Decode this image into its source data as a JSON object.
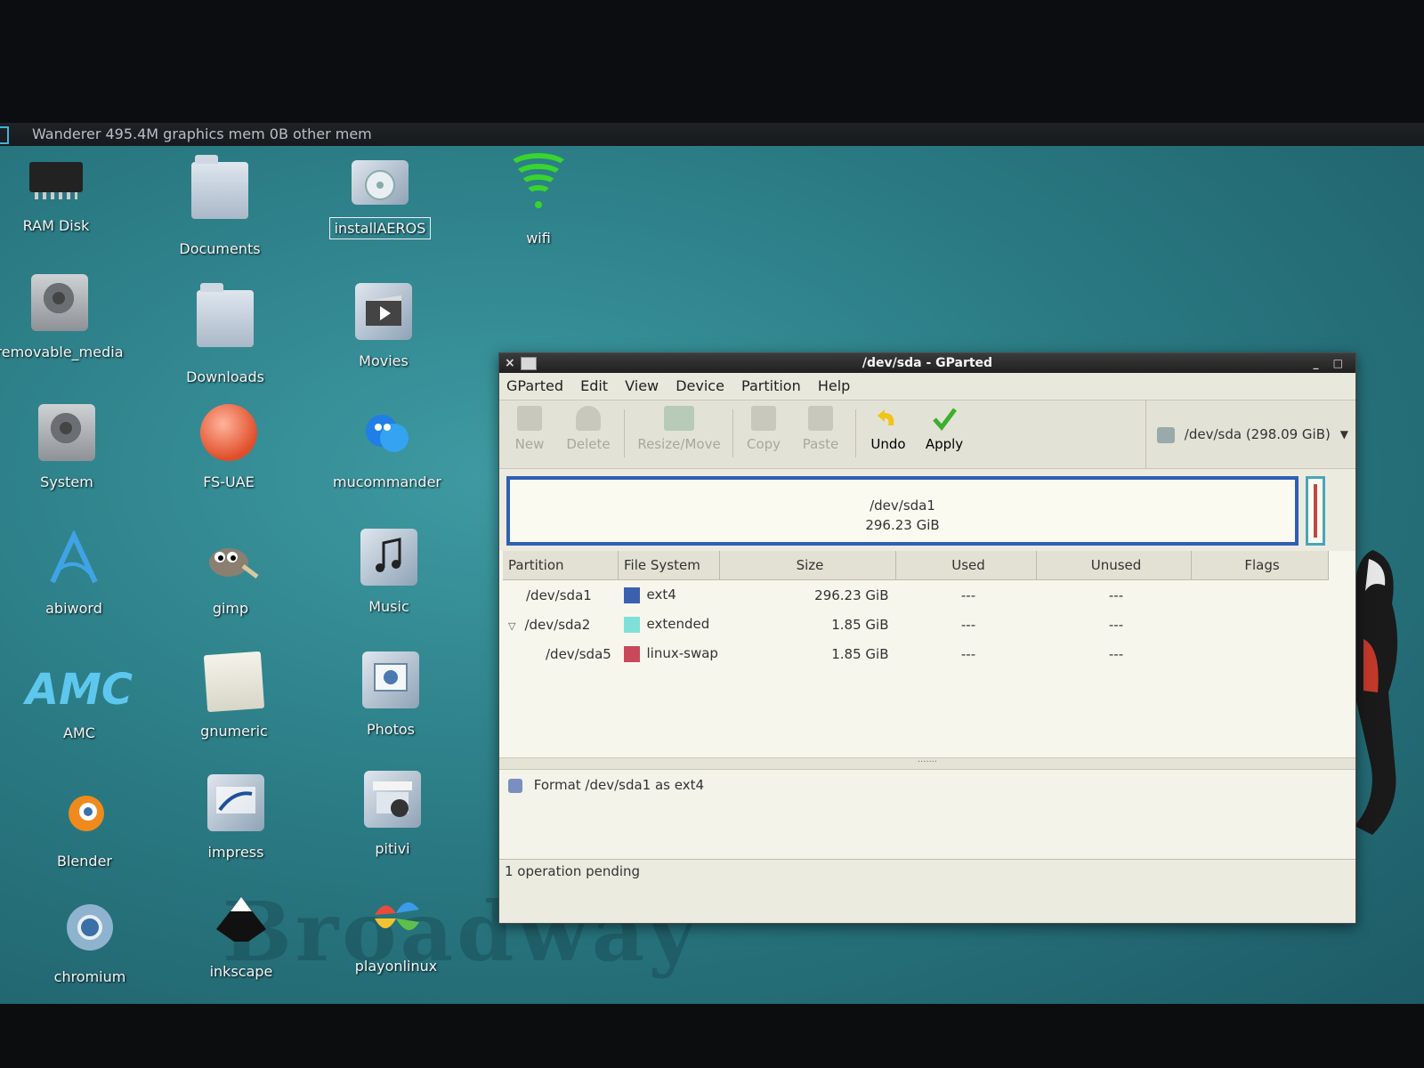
{
  "topbar": {
    "text": "Wanderer 495.4M graphics mem 0B other mem"
  },
  "desktop": {
    "watermark": "Broadway",
    "icons": [
      {
        "label": "RAM Disk"
      },
      {
        "label": "Documents"
      },
      {
        "label": "installAEROS"
      },
      {
        "label": "wifi"
      },
      {
        "label": "removable_media"
      },
      {
        "label": "Downloads"
      },
      {
        "label": "Movies"
      },
      {
        "label": "System"
      },
      {
        "label": "FS-UAE"
      },
      {
        "label": "mucommander"
      },
      {
        "label": "abiword"
      },
      {
        "label": "gimp"
      },
      {
        "label": "Music"
      },
      {
        "label": "AMC",
        "logo": "AMC"
      },
      {
        "label": "gnumeric"
      },
      {
        "label": "Photos"
      },
      {
        "label": "Blender"
      },
      {
        "label": "impress"
      },
      {
        "label": "pitivi"
      },
      {
        "label": "chromium"
      },
      {
        "label": "inkscape"
      },
      {
        "label": "playonlinux"
      }
    ]
  },
  "window": {
    "title": "/dev/sda - GParted",
    "close": "×",
    "controls": "_ □",
    "menu": [
      "GParted",
      "Edit",
      "View",
      "Device",
      "Partition",
      "Help"
    ],
    "toolbar": [
      {
        "label": "New",
        "enabled": false
      },
      {
        "label": "Delete",
        "enabled": false
      },
      {
        "label": "Resize/Move",
        "enabled": false
      },
      {
        "label": "Copy",
        "enabled": false
      },
      {
        "label": "Paste",
        "enabled": false
      },
      {
        "label": "Undo",
        "enabled": true
      },
      {
        "label": "Apply",
        "enabled": true
      }
    ],
    "device": {
      "name": "/dev/sda",
      "size": "(298.09 GiB)"
    },
    "map": {
      "name": "/dev/sda1",
      "size": "296.23 GiB"
    },
    "columns": [
      "Partition",
      "File System",
      "Size",
      "Used",
      "Unused",
      "Flags"
    ],
    "rows": [
      {
        "partition": "/dev/sda1",
        "fs": "ext4",
        "color": "#3c5fb0",
        "size": "296.23 GiB",
        "used": "---",
        "unused": "---",
        "flags": ""
      },
      {
        "partition": "/dev/sda2",
        "fs": "extended",
        "color": "#7fe0d8",
        "size": "1.85 GiB",
        "used": "---",
        "unused": "---",
        "flags": ""
      },
      {
        "partition": "/dev/sda5",
        "fs": "linux-swap",
        "color": "#c9485a",
        "size": "1.85 GiB",
        "used": "---",
        "unused": "---",
        "flags": ""
      }
    ],
    "operations": [
      "Format /dev/sda1 as ext4"
    ],
    "status": "1 operation pending"
  }
}
